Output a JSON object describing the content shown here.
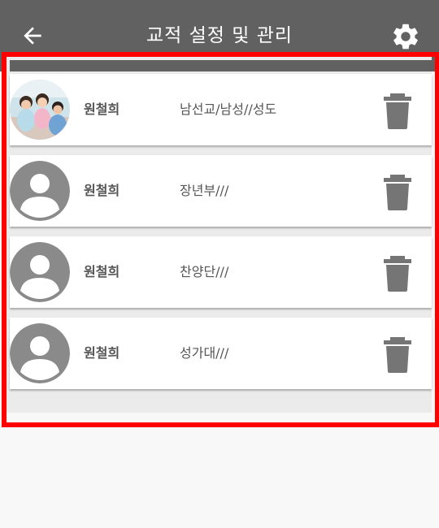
{
  "header": {
    "title": "교적 설정 및 관리",
    "back_icon": "arrow-left-icon",
    "settings_icon": "gear-icon",
    "background": "#616161"
  },
  "members": [
    {
      "name": "원철희",
      "groups": "남선교/남성//성도",
      "avatar": "photo",
      "delete_icon": "trash-icon"
    },
    {
      "name": "원철희",
      "groups": "장년부///",
      "avatar": "default-person-icon",
      "delete_icon": "trash-icon"
    },
    {
      "name": "원철희",
      "groups": "찬양단///",
      "avatar": "default-person-icon",
      "delete_icon": "trash-icon"
    },
    {
      "name": "원철희",
      "groups": "성가대///",
      "avatar": "default-person-icon",
      "delete_icon": "trash-icon"
    }
  ],
  "colors": {
    "highlight_border": "#ff0000",
    "icon_gray": "#757575",
    "avatar_gray": "#8a8a8a"
  }
}
